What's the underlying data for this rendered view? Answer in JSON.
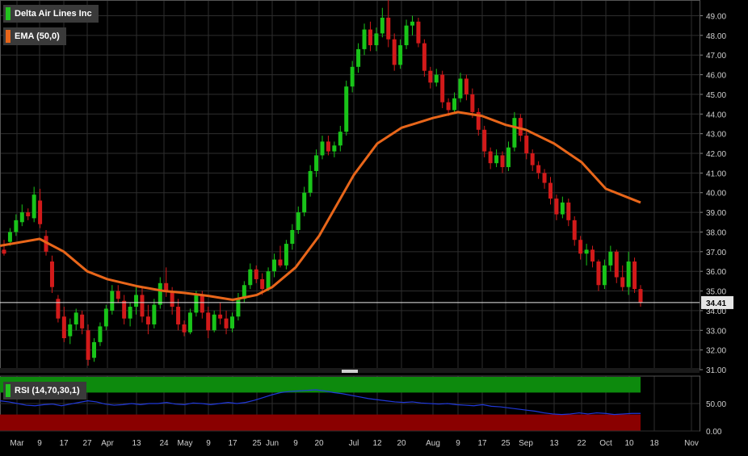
{
  "legend": {
    "symbol": "Delta Air Lines Inc",
    "symbol_color": "#22c11e",
    "ema": "EMA (50,0)",
    "ema_color": "#e8661a",
    "rsi": "RSI (14,70,30,1)",
    "rsi_color": "#22c11e"
  },
  "colors": {
    "up": "#19c419",
    "down": "#d21a1a",
    "grid": "#2e2e2e",
    "rsi_overbought_band": "#0d8a0d",
    "rsi_oversold_band": "#8a0000",
    "rsi_line": "#2038d8"
  },
  "chart_data": [
    {
      "type": "candlestick",
      "x_tick_labels": [
        "Mar",
        "9",
        "17",
        "27",
        "Apr",
        "13",
        "24",
        "May",
        "9",
        "17",
        "25",
        "Jun",
        "9",
        "20",
        "Jul",
        "12",
        "20",
        "Aug",
        "9",
        "17",
        "25",
        "Sep",
        "13",
        "22",
        "Oct",
        "10",
        "18",
        "Nov"
      ],
      "y_tick_labels": [
        "49.00",
        "48.00",
        "47.00",
        "46.00",
        "45.00",
        "44.00",
        "43.00",
        "42.00",
        "41.00",
        "40.00",
        "39.00",
        "38.00",
        "37.00",
        "36.00",
        "35.00",
        "34.00",
        "33.00",
        "32.00",
        "31.00"
      ],
      "ylim": [
        31,
        49.8
      ],
      "last_price": "34.41",
      "last_price_value": 34.41,
      "ema_period_label": "EMA (50,0)",
      "ema_curve": [
        [
          "Mar",
          37.3
        ],
        [
          "9",
          37.65
        ],
        [
          "17",
          37.0
        ],
        [
          "27",
          36.0
        ],
        [
          "Apr",
          35.6
        ],
        [
          "13",
          35.25
        ],
        [
          "24",
          35.0
        ],
        [
          "May",
          34.9
        ],
        [
          "9",
          34.75
        ],
        [
          "17",
          34.55
        ],
        [
          "25",
          34.8
        ],
        [
          "Jun",
          35.2
        ],
        [
          "9",
          36.2
        ],
        [
          "20",
          37.8
        ],
        [
          "Jul",
          40.9
        ],
        [
          "12",
          42.5
        ],
        [
          "20",
          43.3
        ],
        [
          "Aug",
          43.8
        ],
        [
          "9",
          44.1
        ],
        [
          "17",
          43.9
        ],
        [
          "25",
          43.45
        ],
        [
          "Sep",
          43.2
        ],
        [
          "13",
          42.5
        ],
        [
          "22",
          41.55
        ],
        [
          "Oct",
          40.2
        ],
        [
          "10",
          39.5
        ]
      ],
      "candles": [
        [
          37.1,
          37.6,
          36.8,
          36.9
        ],
        [
          37.5,
          38.2,
          37.3,
          38.0
        ],
        [
          38.0,
          38.9,
          37.8,
          38.6
        ],
        [
          38.5,
          39.4,
          38.3,
          39.0
        ],
        [
          39.0,
          39.2,
          38.6,
          38.8
        ],
        [
          38.7,
          40.3,
          38.5,
          39.9
        ],
        [
          39.6,
          40.2,
          38.2,
          38.4
        ],
        [
          37.8,
          38.1,
          36.8,
          37.0
        ],
        [
          36.5,
          36.8,
          34.9,
          35.2
        ],
        [
          34.6,
          34.8,
          33.4,
          33.6
        ],
        [
          33.7,
          34.2,
          32.4,
          32.6
        ],
        [
          32.7,
          33.6,
          32.3,
          33.3
        ],
        [
          33.3,
          34.1,
          33.0,
          33.9
        ],
        [
          33.8,
          34.0,
          32.8,
          33.1
        ],
        [
          33.0,
          33.3,
          31.2,
          31.5
        ],
        [
          31.6,
          32.6,
          31.4,
          32.4
        ],
        [
          32.4,
          33.4,
          32.2,
          33.2
        ],
        [
          33.2,
          34.3,
          33.0,
          34.1
        ],
        [
          34.0,
          35.3,
          33.8,
          35.0
        ],
        [
          35.0,
          35.3,
          34.4,
          34.6
        ],
        [
          34.5,
          34.8,
          33.3,
          33.6
        ],
        [
          33.6,
          34.4,
          33.2,
          34.2
        ],
        [
          34.2,
          35.2,
          33.8,
          34.8
        ],
        [
          34.8,
          35.2,
          33.4,
          33.7
        ],
        [
          33.7,
          34.3,
          32.8,
          33.3
        ],
        [
          33.3,
          34.6,
          33.1,
          34.3
        ],
        [
          34.3,
          35.7,
          34.1,
          35.4
        ],
        [
          35.4,
          36.2,
          34.7,
          35.0
        ],
        [
          35.0,
          35.2,
          33.8,
          34.2
        ],
        [
          34.2,
          34.6,
          33.0,
          33.3
        ],
        [
          33.3,
          33.5,
          32.7,
          32.9
        ],
        [
          32.9,
          34.1,
          32.8,
          33.9
        ],
        [
          33.9,
          35.0,
          33.7,
          34.8
        ],
        [
          34.8,
          35.0,
          33.6,
          33.9
        ],
        [
          33.9,
          34.2,
          32.6,
          33.0
        ],
        [
          33.0,
          34.0,
          32.9,
          33.8
        ],
        [
          33.8,
          34.4,
          33.3,
          33.6
        ],
        [
          33.6,
          34.0,
          32.8,
          33.1
        ],
        [
          33.1,
          33.9,
          32.9,
          33.7
        ],
        [
          33.7,
          34.9,
          33.5,
          34.6
        ],
        [
          34.6,
          35.5,
          34.4,
          35.3
        ],
        [
          35.3,
          36.4,
          35.1,
          36.1
        ],
        [
          36.1,
          36.3,
          35.4,
          35.6
        ],
        [
          35.6,
          35.9,
          34.8,
          35.1
        ],
        [
          35.1,
          36.2,
          35.0,
          36.0
        ],
        [
          36.0,
          36.9,
          35.7,
          36.6
        ],
        [
          36.6,
          37.3,
          36.2,
          36.3
        ],
        [
          36.3,
          37.6,
          36.1,
          37.4
        ],
        [
          37.4,
          38.4,
          37.1,
          38.1
        ],
        [
          38.1,
          39.3,
          37.9,
          39.0
        ],
        [
          39.0,
          40.3,
          38.8,
          40.0
        ],
        [
          40.0,
          41.4,
          39.8,
          41.1
        ],
        [
          41.1,
          42.2,
          40.8,
          41.9
        ],
        [
          41.9,
          42.9,
          41.7,
          42.6
        ],
        [
          42.6,
          42.9,
          41.9,
          42.1
        ],
        [
          42.1,
          42.6,
          41.8,
          42.4
        ],
        [
          42.4,
          43.4,
          42.1,
          43.1
        ],
        [
          43.1,
          45.7,
          42.9,
          45.4
        ],
        [
          45.4,
          46.7,
          45.1,
          46.4
        ],
        [
          46.4,
          47.6,
          46.1,
          47.3
        ],
        [
          47.3,
          48.6,
          47.0,
          48.3
        ],
        [
          48.3,
          48.7,
          47.2,
          47.5
        ],
        [
          47.5,
          48.4,
          47.2,
          48.1
        ],
        [
          48.1,
          49.4,
          47.9,
          48.9
        ],
        [
          48.9,
          49.8,
          47.4,
          47.8
        ],
        [
          47.8,
          48.1,
          46.2,
          46.5
        ],
        [
          46.5,
          47.8,
          46.3,
          47.5
        ],
        [
          47.5,
          48.8,
          47.3,
          48.5
        ],
        [
          48.5,
          49.0,
          48.0,
          48.7
        ],
        [
          48.7,
          48.9,
          47.4,
          47.6
        ],
        [
          47.6,
          47.8,
          45.9,
          46.2
        ],
        [
          46.2,
          46.4,
          45.3,
          45.6
        ],
        [
          45.6,
          46.3,
          45.4,
          46.0
        ],
        [
          46.0,
          46.2,
          44.3,
          44.6
        ],
        [
          44.6,
          44.8,
          43.9,
          44.2
        ],
        [
          44.2,
          45.1,
          44.0,
          44.8
        ],
        [
          44.8,
          46.1,
          44.6,
          45.8
        ],
        [
          45.8,
          46.0,
          44.7,
          45.0
        ],
        [
          45.0,
          45.3,
          43.8,
          44.1
        ],
        [
          44.1,
          44.3,
          42.9,
          43.2
        ],
        [
          43.2,
          43.4,
          41.8,
          42.1
        ],
        [
          42.1,
          42.3,
          41.2,
          41.5
        ],
        [
          41.5,
          42.2,
          41.3,
          41.9
        ],
        [
          41.9,
          42.1,
          41.0,
          41.3
        ],
        [
          41.3,
          42.6,
          41.1,
          42.3
        ],
        [
          42.3,
          44.1,
          42.1,
          43.8
        ],
        [
          43.8,
          44.0,
          42.6,
          42.9
        ],
        [
          42.9,
          43.1,
          41.7,
          42.0
        ],
        [
          42.0,
          42.2,
          41.1,
          41.4
        ],
        [
          41.4,
          41.6,
          40.7,
          41.0
        ],
        [
          41.0,
          41.2,
          40.2,
          40.5
        ],
        [
          40.5,
          40.8,
          39.4,
          39.7
        ],
        [
          39.7,
          39.9,
          38.6,
          38.9
        ],
        [
          38.9,
          39.8,
          38.7,
          39.5
        ],
        [
          39.5,
          39.7,
          38.3,
          38.6
        ],
        [
          38.6,
          38.8,
          37.3,
          37.6
        ],
        [
          37.6,
          37.8,
          36.6,
          36.9
        ],
        [
          36.9,
          37.4,
          36.3,
          37.1
        ],
        [
          37.1,
          37.3,
          36.2,
          36.5
        ],
        [
          36.5,
          36.6,
          35.0,
          35.3
        ],
        [
          35.3,
          36.6,
          35.1,
          36.3
        ],
        [
          36.3,
          37.3,
          36.0,
          37.0
        ],
        [
          37.0,
          37.1,
          35.4,
          35.7
        ],
        [
          35.7,
          36.3,
          35.0,
          35.2
        ],
        [
          35.2,
          37.0,
          34.8,
          36.5
        ],
        [
          36.5,
          36.7,
          34.9,
          35.1
        ],
        [
          35.1,
          35.3,
          34.2,
          34.41
        ]
      ]
    },
    {
      "type": "line",
      "title": "RSI (14,70,30,1)",
      "y_tick_labels": [
        "50.00",
        "0.00"
      ],
      "ylim": [
        0,
        100
      ],
      "overbought": 70,
      "oversold": 30,
      "values": [
        55,
        53,
        50,
        47,
        46,
        48,
        49,
        46,
        49,
        52,
        55,
        53,
        49,
        47,
        48,
        50,
        48,
        50,
        50,
        52,
        49,
        48,
        51,
        50,
        48,
        50,
        52,
        50,
        52,
        56,
        61,
        66,
        70,
        72,
        73,
        74,
        75,
        73,
        70,
        68,
        65,
        62,
        59,
        57,
        55,
        53,
        52,
        53,
        51,
        50,
        49,
        50,
        48,
        47,
        46,
        48,
        45,
        44,
        42,
        40,
        38,
        36,
        33,
        31,
        30,
        31,
        33,
        31,
        33,
        32,
        30,
        31,
        32,
        32
      ]
    }
  ]
}
